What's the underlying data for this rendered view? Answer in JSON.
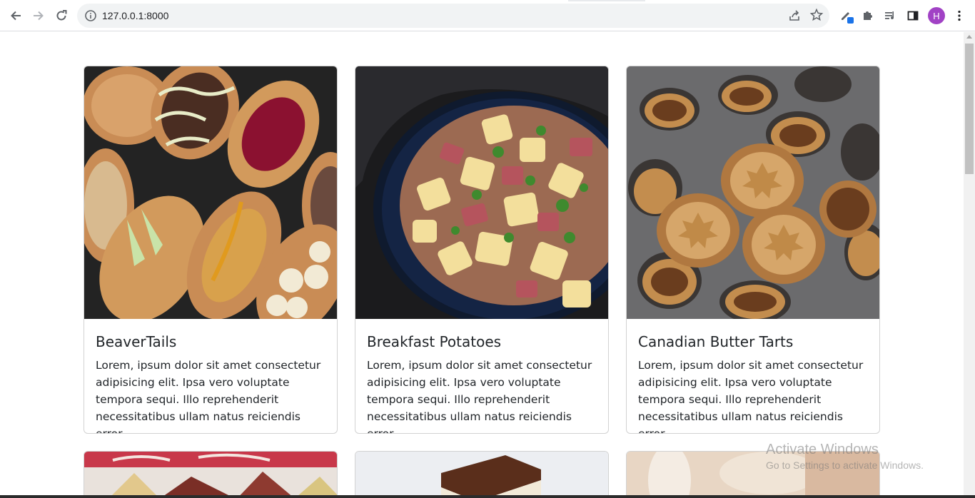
{
  "browser": {
    "url": "127.0.0.1:8000",
    "profile_initial": "H",
    "profile_color": "#a142c5"
  },
  "cards": [
    {
      "title": "BeaverTails",
      "text": "Lorem, ipsum dolor sit amet consectetur adipisicing elit. Ipsa vero voluptate tempora sequi. Illo reprehenderit necessitatibus ullam natus reiciendis error.",
      "image": "fried-dough-pastries-photo"
    },
    {
      "title": "Breakfast Potatoes",
      "text": "Lorem, ipsum dolor sit amet consectetur adipisicing elit. Ipsa vero voluptate tempora sequi. Illo reprehenderit necessitatibus ullam natus reiciendis error.",
      "image": "skillet-potatoes-photo"
    },
    {
      "title": "Canadian Butter Tarts",
      "text": "Lorem, ipsum dolor sit amet consectetur adipisicing elit. Ipsa vero voluptate tempora sequi. Illo reprehenderit necessitatibus ullam natus reiciendis error.",
      "image": "butter-tarts-photo"
    }
  ],
  "partial_cards": [
    {
      "image": "sandwich-photo"
    },
    {
      "image": "nanaimo-bar-photo"
    },
    {
      "image": "dessert-photo"
    }
  ],
  "watermark": {
    "title": "Activate Windows",
    "subtitle": "Go to Settings to activate Windows."
  }
}
